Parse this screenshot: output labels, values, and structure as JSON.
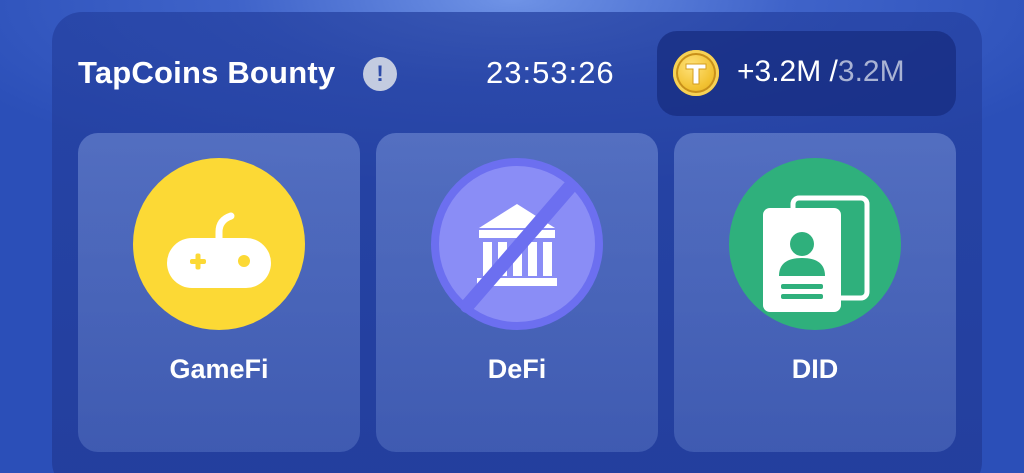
{
  "bounty": {
    "title": "TapCoins Bounty",
    "info_symbol": "!",
    "timer": "23:53:26",
    "reward": {
      "gained": "+3.2M /",
      "total": "3.2M",
      "coin_letter": "T"
    }
  },
  "cards": [
    {
      "label": "GameFi",
      "icon": "gamepad-icon",
      "color": "#fcd935"
    },
    {
      "label": "DeFi",
      "icon": "bank-disabled-icon",
      "color": "#6c6ff0"
    },
    {
      "label": "DID",
      "icon": "id-card-icon",
      "color": "#2fb07c"
    }
  ]
}
